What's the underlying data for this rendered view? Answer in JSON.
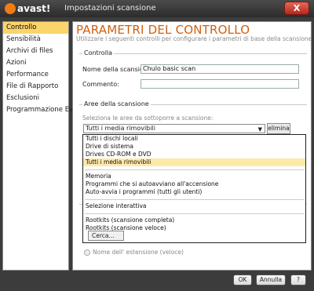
{
  "titlebar": {
    "logo_text": "avast!",
    "title": "Impostazioni scansione",
    "close_label": "X"
  },
  "sidebar": {
    "items": [
      {
        "label": "Controllo",
        "active": true
      },
      {
        "label": "Sensibilità",
        "active": false
      },
      {
        "label": "Archivi di files",
        "active": false
      },
      {
        "label": "Azioni",
        "active": false
      },
      {
        "label": "Performance",
        "active": false
      },
      {
        "label": "File di Rapporto",
        "active": false
      },
      {
        "label": "Esclusioni",
        "active": false
      },
      {
        "label": "Programmazione Eventi",
        "active": false
      }
    ]
  },
  "main": {
    "title": "PARAMETRI DEL CONTROLLO",
    "subtitle": "Utilizzare i seguenti controlli per configurare i parametri di base della scansione.",
    "controllo_group": {
      "title": "Controlla",
      "name_label": "Nome della scansione:",
      "name_value": "Chulo basic scan",
      "comment_label": "Commento:",
      "comment_value": ""
    },
    "areas_group": {
      "title": "Aree della scansione",
      "instruction": "Seleziona le aree da sottoporre a scansione:",
      "selected": "Tutti i media rimovibili",
      "elimina_label": "elimina"
    },
    "radio_label": "Nome dell' estensione (veloce)"
  },
  "dropdown": {
    "group1": [
      "Tutti i dischi locali",
      "Drive di sistema",
      "Drives CD-ROM e DVD",
      "Tutti i media rimovibili"
    ],
    "group2": [
      "Memoria",
      "Programmi che si autoavviano all'accensione",
      "Auto-avvia i programmi (tutti gli utenti)"
    ],
    "group3": [
      "Selezione interattiva"
    ],
    "group4": [
      "Rootkits (scansione completa)",
      "Rootkits (scansione veloce)"
    ],
    "highlighted": "Tutti i media rimovibili",
    "cerca_label": "Cerca..."
  },
  "footer": {
    "ok_label": "OK",
    "cancel_label": "Annulla",
    "help_label": "?"
  },
  "colors": {
    "accent": "#d06010",
    "highlight": "#fbd46a"
  }
}
